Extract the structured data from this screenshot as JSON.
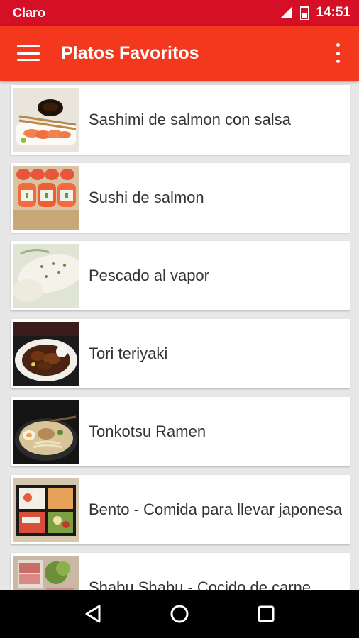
{
  "status_bar": {
    "carrier": "Claro",
    "time": "14:51"
  },
  "app_bar": {
    "title": "Platos Favoritos"
  },
  "dishes": [
    {
      "name": "Sashimi de salmon con salsa",
      "image": "sashimi-photo"
    },
    {
      "name": "Sushi de salmon",
      "image": "sushi-photo"
    },
    {
      "name": "Pescado al vapor",
      "image": "steamed-fish-photo"
    },
    {
      "name": "Tori teriyaki",
      "image": "teriyaki-photo"
    },
    {
      "name": "Tonkotsu Ramen",
      "image": "ramen-photo"
    },
    {
      "name": "Bento - Comida para llevar japonesa",
      "image": "bento-photo"
    },
    {
      "name": "Shabu Shabu - Cocido de carne",
      "image": "shabu-photo"
    }
  ],
  "nav_bar": {
    "back": "back-icon",
    "home": "home-icon",
    "recents": "recents-icon"
  },
  "colors": {
    "status_bar": "#d50f25",
    "app_bar": "#f4381e",
    "background": "#e7e7e7"
  }
}
